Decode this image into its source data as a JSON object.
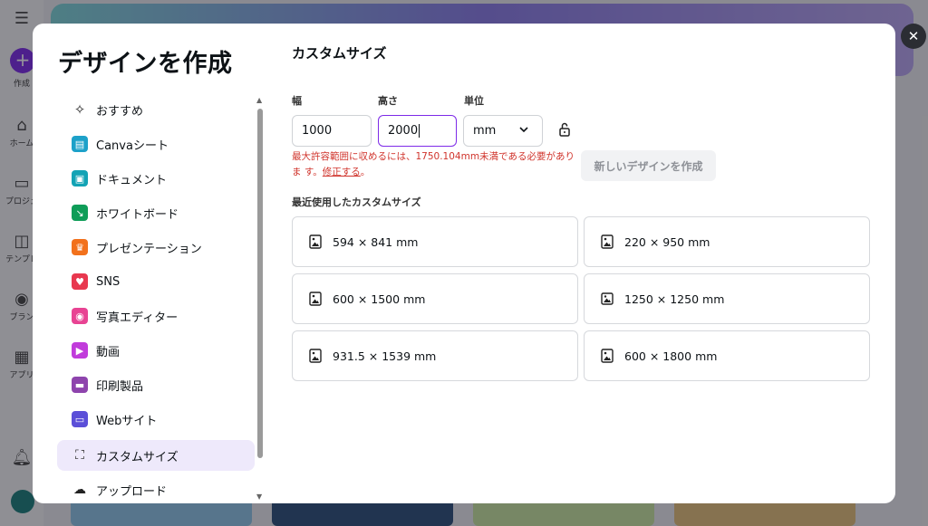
{
  "background": {
    "rail": [
      {
        "label": "作成",
        "icon": "plus-icon"
      },
      {
        "label": "ホーム",
        "icon": "home-icon"
      },
      {
        "label": "プロジェ",
        "icon": "folder-icon"
      },
      {
        "label": "テンプレ",
        "icon": "template-icon"
      },
      {
        "label": "ブラン",
        "icon": "brand-icon"
      },
      {
        "label": "アプリ",
        "icon": "apps-icon"
      }
    ]
  },
  "modal": {
    "title": "デザインを作成",
    "close_icon": "close-icon"
  },
  "sidebar": {
    "items": [
      {
        "label": "おすすめ",
        "icon": "sparkle-icon",
        "color": "#222222",
        "active": false
      },
      {
        "label": "Canvaシート",
        "icon": "sheet-icon",
        "color": "#1da1c9",
        "active": false
      },
      {
        "label": "ドキュメント",
        "icon": "document-icon",
        "color": "#13a3b5",
        "active": false
      },
      {
        "label": "ホワイトボード",
        "icon": "whiteboard-icon",
        "color": "#0f9d58",
        "active": false
      },
      {
        "label": "プレゼンテーション",
        "icon": "presentation-icon",
        "color": "#f2711c",
        "active": false
      },
      {
        "label": "SNS",
        "icon": "heart-icon",
        "color": "#e8384f",
        "active": false
      },
      {
        "label": "写真エディター",
        "icon": "camera-icon",
        "color": "#e84393",
        "active": false
      },
      {
        "label": "動画",
        "icon": "video-icon",
        "color": "#c13cdb",
        "active": false
      },
      {
        "label": "印刷製品",
        "icon": "printer-icon",
        "color": "#8e44ad",
        "active": false
      },
      {
        "label": "Webサイト",
        "icon": "website-icon",
        "color": "#5b4fd8",
        "active": false
      },
      {
        "label": "カスタムサイズ",
        "icon": "custom-size-icon",
        "color": "#222222",
        "active": true
      },
      {
        "label": "アップロード",
        "icon": "upload-icon",
        "color": "#222222",
        "active": false
      }
    ]
  },
  "custom": {
    "section_title": "カスタムサイズ",
    "width_label": "幅",
    "width_value": "1000",
    "height_label": "高さ",
    "height_value": "2000",
    "unit_label": "単位",
    "unit_value": "mm",
    "error_text": "最大許容範囲に収めるには、1750.104mm未満である必要がありま す。",
    "error_link": "修正する",
    "error_tail": "。",
    "create_button": "新しいデザインを作成",
    "recent_title": "最近使用したカスタムサイズ",
    "recent": [
      {
        "label": "594 × 841 mm"
      },
      {
        "label": "220 × 950 mm"
      },
      {
        "label": "600 × 1500 mm"
      },
      {
        "label": "1250 × 1250 mm"
      },
      {
        "label": "931.5 × 1539 mm"
      },
      {
        "label": "600 × 1800 mm"
      }
    ]
  }
}
